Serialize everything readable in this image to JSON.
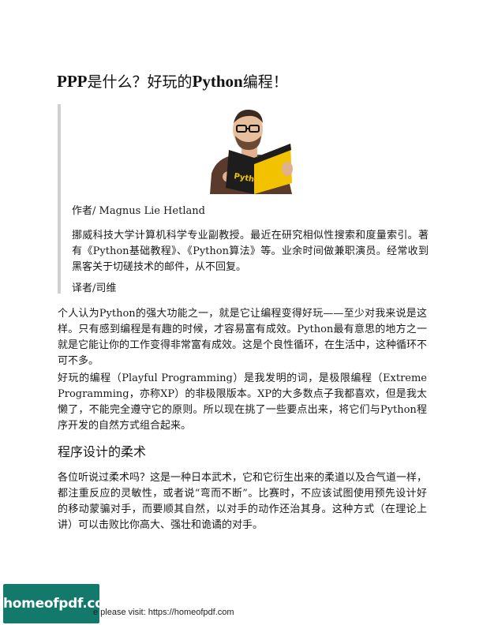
{
  "title": {
    "prefix": "PPP",
    "middle": "是什么？好玩的",
    "python": "Python",
    "suffix": "编程！"
  },
  "quote": {
    "photo_icon": "person-reading-python-book",
    "byline": "作者/ Magnus Lie Hetland",
    "bio": "挪威科技大学计算机科学专业副教授。最近在研究相似性搜索和度量索引。著有《Python基础教程》、《Python算法》等。业余时间做兼职演员。经常收到黑客关于切磋技术的邮件，从不回复。",
    "translator": "译者/司维"
  },
  "paragraphs": [
    "个人认为Python的强大功能之一，就是它让编程变得好玩——至少对我来说是这样。只有感到编程是有趣的时候，才容易富有成效。Python最有意思的地方之一就是它能让你的工作变得非常富有成效。这是个良性循环，在生活中，这种循环不可不多。",
    "好玩的编程（Playful Programming）是我发明的词，是极限编程（Extreme Programming，亦称XP）的非极限版本。XP的大多数点子我都喜欢，但是我太懒了，不能完全遵守它的原则。所以现在挑了一些要点出来，将它们与Python程序开发的自然方式组合起来。"
  ],
  "section": {
    "heading": "程序设计的柔术",
    "body": "各位听说过柔术吗？这是一种日本武术，它和它衍生出来的柔道以及合气道一样，都注重反应的灵敏性，或者说“弯而不断”。比赛时，不应该试图使用预先设计好的移动蒙骗对手，而要顺其自然，以对手的动作还治其身。这种方式（在理论上讲）可以击败比你高大、强壮和诡谲的对手。"
  },
  "footer": {
    "logo_text": "homeofpdf.com",
    "text": "e please visit: https://homeofpdf.com"
  },
  "colors": {
    "logo_bg": "#137a6b",
    "book_yellow": "#f2c200",
    "quote_bar": "#d0d0d0"
  }
}
